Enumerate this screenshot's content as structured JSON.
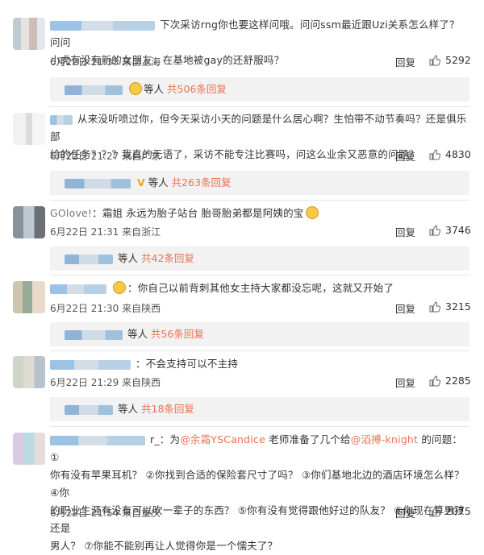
{
  "comments": [
    {
      "text_line1": "下次采访rng你也要这样问哦。问问ssm最近跟Uzi关系怎么样了？问问",
      "text_line2": "小虎有没有新的女朋友，在基地被gay的还舒服吗？",
      "time": "6月22日 21:33",
      "from": "来自上海",
      "reply_label": "回复",
      "likes": "5292",
      "replies_prefix": "等人",
      "replies_count": "共506条回复"
    },
    {
      "text_line1": "从来没听喷过你，但今天采访小天的问题是什么居心啊？生怕带不动节奏吗？还是俱乐部",
      "text_line2": "给的任务？？？我真的无语了，采访不能专注比赛吗，问这么业余又恶意的问题？",
      "time": "6月22日 21:27",
      "from": "来自广东",
      "reply_label": "回复",
      "likes": "4830",
      "replies_prefix": "等人",
      "replies_count": "共263条回复"
    },
    {
      "user_text": "GOlove!",
      "text_line1": "：霜姐 永远为胎子站台 胎哥胎弟都是阿姨的宝",
      "time": "6月22日 21:31",
      "from": "来自浙江",
      "reply_label": "回复",
      "likes": "3746",
      "replies_prefix": "等人",
      "replies_count": "共42条回复"
    },
    {
      "text_line1": "：你自己以前背刺其他女主持大家都没忘呢，这就又开始了",
      "time": "6月22日 21:30",
      "from": "来自陕西",
      "reply_label": "回复",
      "likes": "3215",
      "replies_prefix": "等人",
      "replies_count": "共56条回复"
    },
    {
      "text_line1": "：不会支持可以不主持",
      "time": "6月22日 21:29",
      "from": "来自陕西",
      "reply_label": "回复",
      "likes": "2285",
      "replies_prefix": "等人",
      "replies_count": "共18条回复"
    },
    {
      "user_text": "r_",
      "text_line1a": "：为",
      "mention1": "@余霜YSCandice",
      "text_line1b": " 老师准备了几个给",
      "mention2": "@滔搏-knight",
      "text_line1c": " 的问题： ①",
      "text_line2": "你有没有苹果耳机？ ②你找到合适的保险套尺寸了吗？ ③你们基地北边的酒店环境怎么样？ ④你",
      "text_line3": "的职业生涯有没有可以吹一辈子的东西？ ⑤你有没有觉得跟他好过的队友？ ⑥你现在算男孩还是",
      "text_line4": "男人？ ⑦你能不能别再让人觉得你是一个懦夫了？",
      "time": "6月22日 21:54",
      "from": "来自重庆",
      "reply_label": "回复",
      "likes": "2075"
    }
  ],
  "colors": {
    "accent": "#eb7350",
    "reply_bg": "#f2f2f2"
  },
  "icons": {
    "like": "thumbs-up-icon"
  }
}
